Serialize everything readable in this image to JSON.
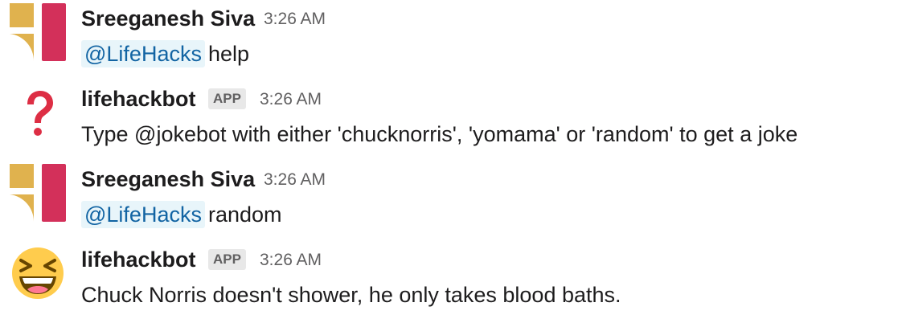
{
  "messages": [
    {
      "author": "Sreeganesh Siva",
      "time": "3:26 AM",
      "mention": "@LifeHacks",
      "text": "help",
      "avatar_icon": "user-logo-icon"
    },
    {
      "author": "lifehackbot",
      "badge": "APP",
      "time": "3:26 AM",
      "text": "Type @jokebot with either 'chucknorris', 'yomama' or 'random' to get a joke",
      "avatar_icon": "question-mark-icon"
    },
    {
      "author": "Sreeganesh Siva",
      "time": "3:26 AM",
      "mention": "@LifeHacks",
      "text": "random",
      "avatar_icon": "user-logo-icon"
    },
    {
      "author": "lifehackbot",
      "badge": "APP",
      "time": "3:26 AM",
      "text": "Chuck Norris doesn't shower, he only takes blood baths.",
      "avatar_icon": "laughing-face-icon"
    }
  ],
  "colors": {
    "logo_gold": "#e0b24e",
    "logo_red": "#d3305a",
    "mention_bg": "#e8f5fa",
    "mention_text": "#1264a3",
    "question_red": "#dd2e44",
    "emoji_yellow": "#ffcc4d"
  }
}
